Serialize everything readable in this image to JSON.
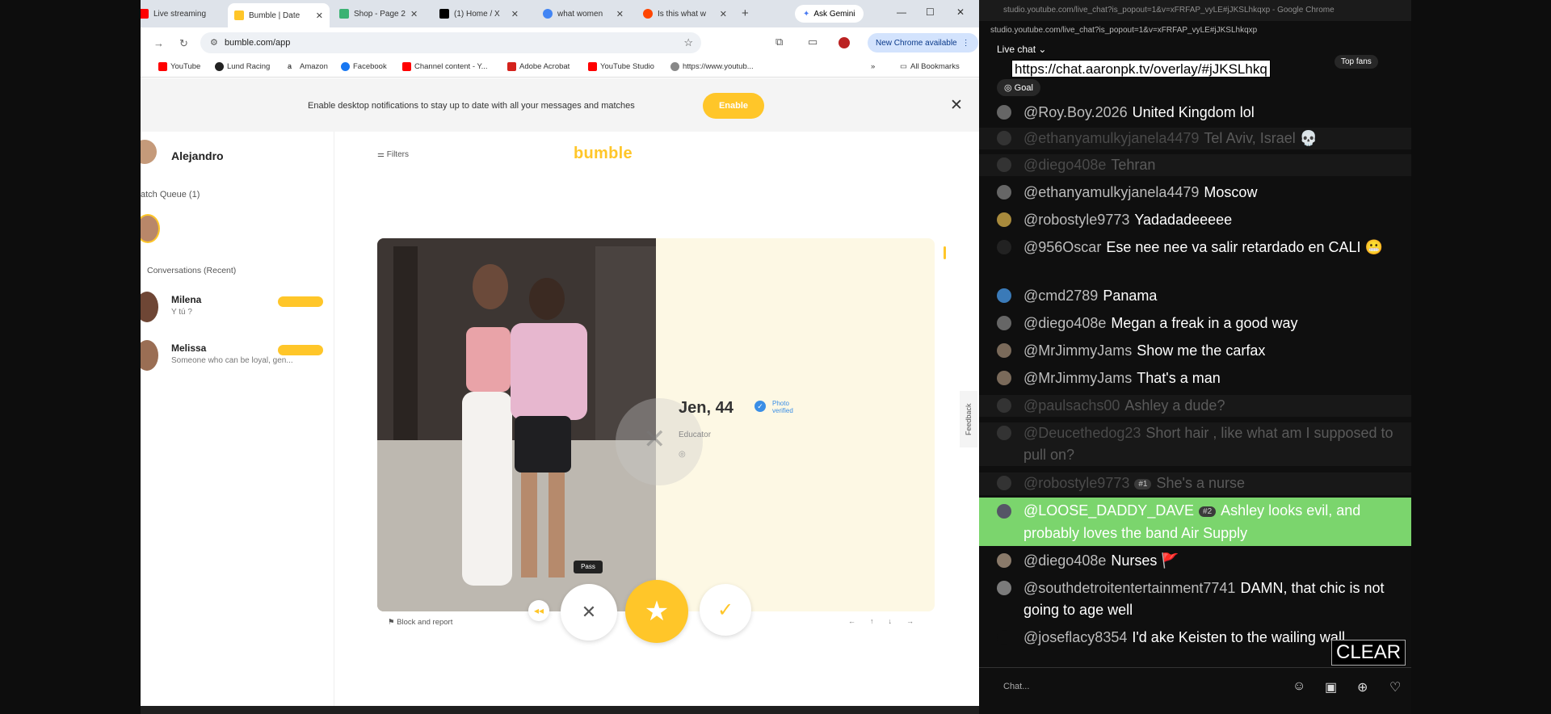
{
  "chrome": {
    "tabs": [
      {
        "label": "Live streaming",
        "color": "#ff0000"
      },
      {
        "label": "Bumble | Date",
        "color": "#ffc629"
      },
      {
        "label": "Shop - Page 2",
        "color": "#3bb273"
      },
      {
        "label": "(1) Home / X",
        "color": "#000000"
      },
      {
        "label": "what women",
        "color": "#4285f4"
      },
      {
        "label": "Is this what w",
        "color": "#ff4500"
      }
    ],
    "gemini": "Ask Gemini",
    "url": "bumble.com/app",
    "new_chrome": "New Chrome available",
    "bookmarks": [
      "YouTube",
      "Lund Racing",
      "Amazon",
      "Facebook",
      "Channel content - Y...",
      "Adobe Acrobat",
      "YouTube Studio",
      "https://www.youtub..."
    ],
    "all_bookmarks": "All Bookmarks"
  },
  "bumble": {
    "notification": "Enable desktop notifications to stay up to date with all your messages and matches",
    "enable_label": "Enable",
    "user_name": "Alejandro",
    "match_queue": "atch Queue  (1)",
    "conversations_label": "Conversations  (Recent)",
    "conversations": [
      {
        "name": "Milena",
        "preview": "Y tú ?"
      },
      {
        "name": "Melissa",
        "preview": "Someone who can be loyal, gen..."
      }
    ],
    "filters": "Filters",
    "logo": "bumble",
    "profile": {
      "name": "Jen, 44",
      "verified": "Photo verified",
      "job": "Educator"
    },
    "pass_tooltip": "Pass",
    "block_report": "Block and report",
    "feedback": "Feedback"
  },
  "youtube_chat": {
    "window_title": "studio.youtube.com/live_chat?is_popout=1&v=xFRFAP_vyLE#jJKSLhkqxp - Google Chrome",
    "url": "studio.youtube.com/live_chat?is_popout=1&v=xFRFAP_vyLE#jJKSLhkqxp",
    "live_chat_label": "Live chat",
    "overlay_url": "https://chat.aaronpk.tv/overlay/#jJKSLhkq",
    "top_fans": "Top fans",
    "goal": "Goal",
    "messages": [
      {
        "author": "@Roy.Boy.2026",
        "text": "United Kingdom lol",
        "style": "normal"
      },
      {
        "author": "@ethanyamulkyjanela4479",
        "text": "Tel Aviv, Israel 💀",
        "style": "dim"
      },
      {
        "author": "@diego408e",
        "text": "Tehran",
        "style": "dim"
      },
      {
        "author": "@ethanyamulkyjanela4479",
        "text": "Moscow",
        "style": "normal"
      },
      {
        "author": "@robostyle9773",
        "text": "Yadadadeeeee",
        "style": "normal"
      },
      {
        "author": "@956Oscar",
        "text": "Ese nee nee va salir retardado en CALI 😬",
        "style": "normal"
      },
      {
        "author": "@cmd2789",
        "text": "Panama",
        "style": "normal"
      },
      {
        "author": "@diego408e",
        "text": "Megan a freak in a good way",
        "style": "normal"
      },
      {
        "author": "@MrJimmyJams",
        "text": "Show me the carfax",
        "style": "normal"
      },
      {
        "author": "@MrJimmyJams",
        "text": "That's a man",
        "style": "normal"
      },
      {
        "author": "@paulsachs00",
        "text": "Ashley a dude?",
        "style": "dim"
      },
      {
        "author": "@Deucethedog23",
        "text": "Short hair , like what am I supposed to pull on?",
        "style": "dim"
      },
      {
        "author": "@robostyle9773",
        "badge": "#1",
        "text": "She's a nurse",
        "style": "dim"
      },
      {
        "author": "@LOOSE_DADDY_DAVE",
        "badge": "#2",
        "text": "Ashley looks evil, and probably loves the band Air Supply",
        "style": "hl"
      },
      {
        "author": "@diego408e",
        "text": "Nurses 🚩",
        "style": "normal"
      },
      {
        "author": "@southdetroitentertainment7741",
        "text": "DAMN, that chic is not going to age well",
        "style": "normal"
      },
      {
        "author": "@joseflacy8354",
        "text": "I'd ake Keisten to the wailing wall",
        "style": "normal"
      }
    ],
    "clear_label": "CLEAR",
    "input_placeholder": "Chat..."
  }
}
